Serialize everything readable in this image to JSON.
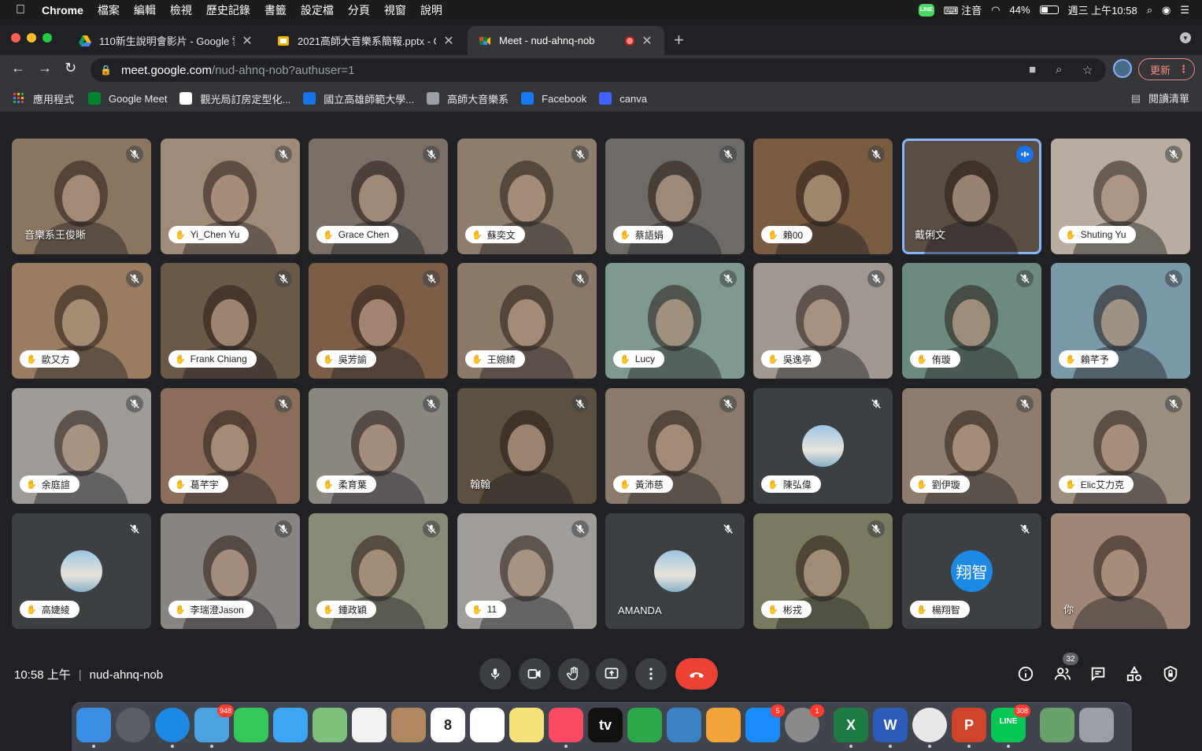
{
  "menubar": {
    "app": "Chrome",
    "menus": [
      "檔案",
      "編輯",
      "檢視",
      "歷史記錄",
      "書籤",
      "設定檔",
      "分頁",
      "視窗",
      "說明"
    ],
    "input_method": "注音",
    "battery": "44%",
    "clock": "週三 上午10:58",
    "line_label": "LINE"
  },
  "tabs": [
    {
      "title": "110新生說明會影片 - Google 雲端硬碟",
      "active": false
    },
    {
      "title": "2021高師大音樂系簡報.pptx - Google 簡報",
      "active": false
    },
    {
      "title": "Meet - nud-ahnq-nob",
      "active": true
    }
  ],
  "address": {
    "host": "meet.google.com",
    "path": "/nud-ahnq-nob?authuser=1"
  },
  "update_label": "更新",
  "bookmarks": [
    {
      "label": "應用程式",
      "color": "#ea4335"
    },
    {
      "label": "Google Meet",
      "color": "#00832d"
    },
    {
      "label": "觀光局訂房定型化...",
      "color": "#ffffff"
    },
    {
      "label": "國立高雄師範大學...",
      "color": "#1a73e8"
    },
    {
      "label": "高師大音樂系",
      "color": "#9aa0a6"
    },
    {
      "label": "Facebook",
      "color": "#1877f2"
    },
    {
      "label": "canva",
      "color": "#4262ff"
    }
  ],
  "reading_list": "閱讀清單",
  "participants": [
    {
      "name": "音樂系王俊晰",
      "style": "plain",
      "bg": "#8a7560"
    },
    {
      "name": "Yi_Chen Yu",
      "style": "pill",
      "bg": "#a08a78"
    },
    {
      "name": "Grace Chen",
      "style": "pill",
      "bg": "#7a7068"
    },
    {
      "name": "蘇奕文",
      "style": "pill",
      "bg": "#8c7d6c"
    },
    {
      "name": "蔡語娟",
      "style": "pill",
      "bg": "#6e6a66"
    },
    {
      "name": "賴00",
      "style": "pill",
      "bg": "#7a5c40"
    },
    {
      "name": "戴俐文",
      "style": "plain",
      "bg": "#5a4e44",
      "speaking": true
    },
    {
      "name": "Shuting Yu",
      "style": "pill",
      "bg": "#b8ada0"
    },
    {
      "name": "歐又方",
      "style": "pill",
      "bg": "#9a7c60"
    },
    {
      "name": "Frank Chiang",
      "style": "pill",
      "bg": "#6a5848"
    },
    {
      "name": "吳芳諭",
      "style": "pill",
      "bg": "#7c5e48"
    },
    {
      "name": "王婉綺",
      "style": "pill",
      "bg": "#8a7868"
    },
    {
      "name": "Lucy",
      "style": "pill",
      "bg": "#7e9a90"
    },
    {
      "name": "吳逸亭",
      "style": "pill",
      "bg": "#a09890"
    },
    {
      "name": "侑璇",
      "style": "pill",
      "bg": "#6c8a7e"
    },
    {
      "name": "賴芊予",
      "style": "pill",
      "bg": "#7a9aaa"
    },
    {
      "name": "余庭諠",
      "style": "pill",
      "bg": "#9e9a96"
    },
    {
      "name": "葛芊宇",
      "style": "pill",
      "bg": "#8a6e5a"
    },
    {
      "name": "柔育葉",
      "style": "pill",
      "bg": "#8c8680"
    },
    {
      "name": "翰翰",
      "style": "plain",
      "bg": "#5e5040"
    },
    {
      "name": "黃沛慈",
      "style": "pill",
      "bg": "#8a7a6c"
    },
    {
      "name": "陳弘偉",
      "style": "pill",
      "bg": "#3c4043",
      "avatar": "photo"
    },
    {
      "name": "劉伊璇",
      "style": "pill",
      "bg": "#8e7c6e"
    },
    {
      "name": "Elic艾力克",
      "style": "pill",
      "bg": "#9c8e80"
    },
    {
      "name": "高婕綾",
      "style": "pill",
      "bg": "#3c4043",
      "avatar": "photo"
    },
    {
      "name": "李瑞澄Jason",
      "style": "pill",
      "bg": "#8a8480"
    },
    {
      "name": "鍾政穎",
      "style": "pill",
      "bg": "#8a8a78"
    },
    {
      "name": "11",
      "style": "pill",
      "bg": "#a09c98"
    },
    {
      "name": "AMANDA",
      "style": "plain",
      "bg": "#3c4043",
      "avatar": "photo"
    },
    {
      "name": "彬戎",
      "style": "pill",
      "bg": "#7a7a60"
    },
    {
      "name": "楊翔智",
      "style": "pill",
      "bg": "#3c4043",
      "avatar": "letter",
      "avatar_text": "翔智"
    },
    {
      "name": "你",
      "style": "plain",
      "bg": "#a08676",
      "self": true
    }
  ],
  "meeting": {
    "time": "10:58 上午",
    "code": "nud-ahnq-nob",
    "participant_count": "32"
  },
  "dock": [
    {
      "name": "finder",
      "color": "#3a8ee6"
    },
    {
      "name": "launchpad",
      "color": "#5a5f66"
    },
    {
      "name": "safari",
      "color": "#1e88e5"
    },
    {
      "name": "mail",
      "color": "#4aa3e0",
      "badge": "948"
    },
    {
      "name": "facetime",
      "color": "#34c759"
    },
    {
      "name": "messages",
      "color": "#3da5f5"
    },
    {
      "name": "maps",
      "color": "#7cc07c"
    },
    {
      "name": "photos",
      "color": "#f2f2f2"
    },
    {
      "name": "contacts",
      "color": "#b08860"
    },
    {
      "name": "calendar",
      "color": "#ffffff",
      "text": "8"
    },
    {
      "name": "reminders",
      "color": "#ffffff"
    },
    {
      "name": "notes",
      "color": "#f7e27a"
    },
    {
      "name": "music",
      "color": "#fa4a64"
    },
    {
      "name": "apple-tv",
      "color": "#111111",
      "text": "tv"
    },
    {
      "name": "numbers",
      "color": "#2ca84a"
    },
    {
      "name": "keynote",
      "color": "#3b82c4"
    },
    {
      "name": "pages",
      "color": "#f2a33a"
    },
    {
      "name": "app-store",
      "color": "#1a8cff",
      "badge": "5"
    },
    {
      "name": "system-preferences",
      "color": "#8a8a8a",
      "badge": "1"
    },
    {
      "name": "excel",
      "color": "#1d7a44",
      "text": "X"
    },
    {
      "name": "word",
      "color": "#2b5ab8",
      "text": "W"
    },
    {
      "name": "chrome",
      "color": "#e8e8e8"
    },
    {
      "name": "powerpoint",
      "color": "#d0442c",
      "text": "P"
    },
    {
      "name": "line",
      "color": "#06c755",
      "text": "LINE",
      "badge": "308"
    },
    {
      "name": "preview",
      "color": "#6aa06a"
    },
    {
      "name": "trash",
      "color": "#9aa0a6"
    }
  ]
}
